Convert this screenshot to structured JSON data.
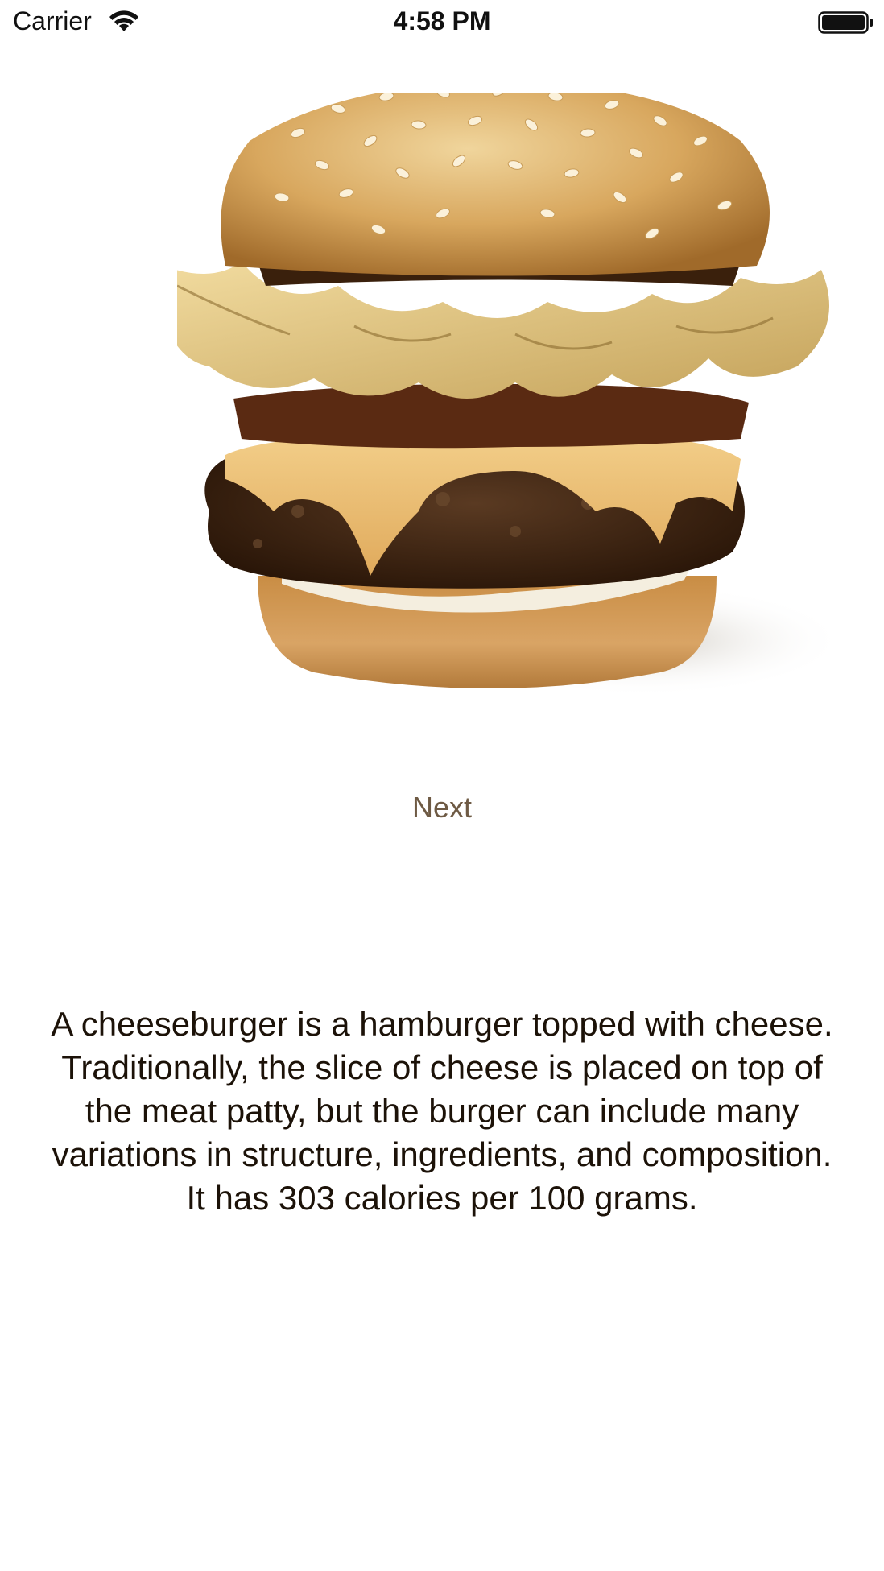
{
  "status_bar": {
    "carrier": "Carrier",
    "time": "4:58 PM",
    "wifi_icon": "wifi-icon",
    "battery_icon": "battery-icon",
    "battery_level": 1.0
  },
  "hero": {
    "icon": "cheeseburger-image"
  },
  "actions": {
    "next_label": "Next"
  },
  "description": {
    "text": "A cheeseburger is a hamburger topped with cheese. Traditionally, the slice of cheese is placed on top of the meat patty, but the burger can include many variations in structure, ingredients, and composition.",
    "calories": "It has 303 calories per 100 grams."
  },
  "colors": {
    "accent": "#6e5a44",
    "text": "#1c1208",
    "background": "#ffffff"
  }
}
